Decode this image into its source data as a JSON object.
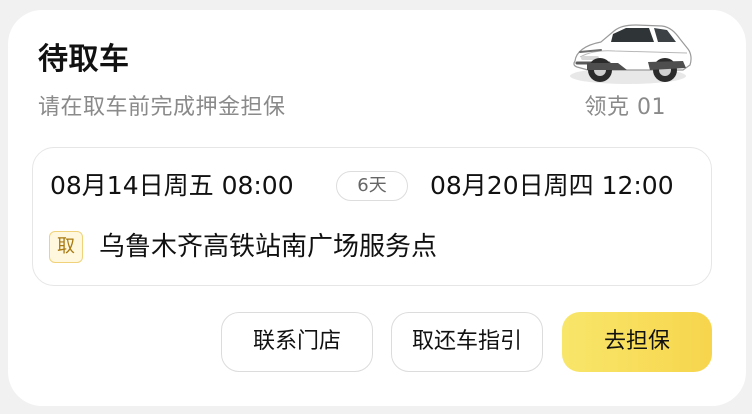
{
  "header": {
    "title": "待取车",
    "subtitle": "请在取车前完成押金担保",
    "car_name": "领克 01",
    "car_image_icon": "white-suv-car-image"
  },
  "rental": {
    "start_time": "08月14日周五 08:00",
    "duration": "6天",
    "end_time": "08月20日周四 12:00",
    "pickup_tag": "取",
    "pickup_location": "乌鲁木齐高铁站南广场服务点"
  },
  "actions": {
    "contact_store": "联系门店",
    "pickup_return_guide": "取还车指引",
    "go_guarantee": "去担保"
  },
  "colors": {
    "primary_button_start": "#f8e66a",
    "primary_button_end": "#f7d54d",
    "pickup_tag_background": "#fff8df",
    "pickup_tag_border": "#f0d27a",
    "pickup_tag_text": "#a87a10"
  }
}
